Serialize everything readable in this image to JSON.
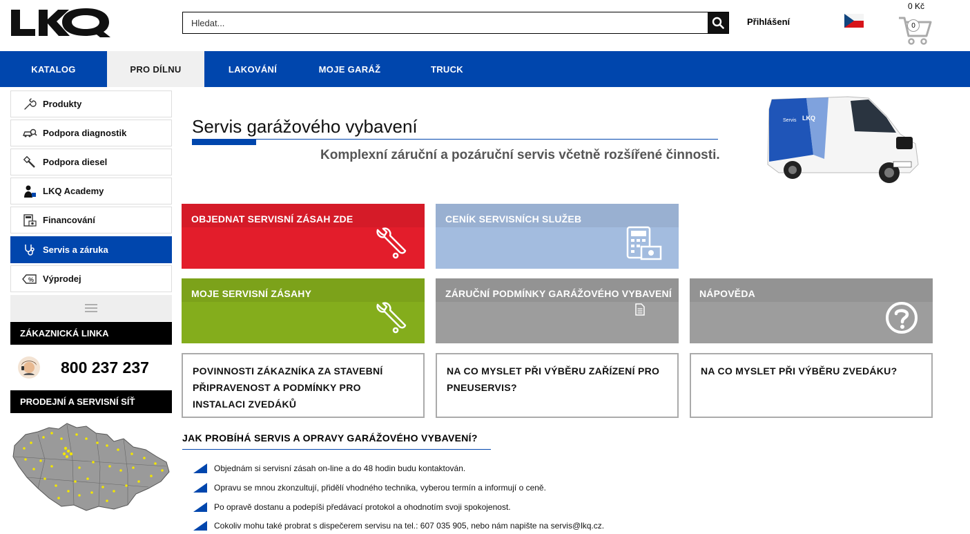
{
  "header": {
    "logo_text": "LKQ",
    "search_placeholder": "Hledat...",
    "login_label": "Přihlášení",
    "cart_price": "0 Kč",
    "cart_count": "0"
  },
  "nav": {
    "items": [
      {
        "label": "KATALOG"
      },
      {
        "label": "PRO DÍLNU"
      },
      {
        "label": "LAKOVÁNÍ"
      },
      {
        "label": "MOJE GARÁŽ"
      },
      {
        "label": "TRUCK"
      }
    ],
    "active_index": 1
  },
  "sidebar": {
    "items": [
      {
        "label": "Produkty",
        "icon": "wrench-icon"
      },
      {
        "label": "Podpora diagnostik",
        "icon": "car-search-icon"
      },
      {
        "label": "Podpora diesel",
        "icon": "injector-icon"
      },
      {
        "label": "LKQ Academy",
        "icon": "teacher-icon"
      },
      {
        "label": "Financování",
        "icon": "calculator-icon"
      },
      {
        "label": "Servis a záruka",
        "icon": "stethoscope-icon"
      },
      {
        "label": "Výprodej",
        "icon": "discount-tag-icon"
      }
    ],
    "active_index": 5,
    "hotline_title": "ZÁKAZNICKÁ LINKA",
    "hotline_number": "800 237 237",
    "network_title": "PRODEJNÍ A SERVISNÍ SÍŤ"
  },
  "main": {
    "title": "Servis garážového vybavení",
    "subtitle": "Komplexní záruční a pozáruční servis  včetně rozšířené činnosti.",
    "tiles": [
      {
        "label": "OBJEDNAT SERVISNÍ ZÁSAH ZDE",
        "color": "#e31d2b",
        "icon": "wrench-icon"
      },
      {
        "label": "CENÍK SERVISNÍCH SLUŽEB",
        "color": "#a3bcdf",
        "icon": "calculator-money-icon"
      },
      {
        "label": "MOJE SERVISNÍ ZÁSAHY",
        "color": "#84ad1c",
        "icon": "wrench-icon"
      },
      {
        "label": "ZÁRUČNÍ PODMÍNKY GARÁŽOVÉHO VYBAVENÍ",
        "color": "#9d9d9d",
        "icon": "document-icon"
      },
      {
        "label": "NÁPOVĚDA",
        "color": "#9d9d9d",
        "icon": "question-icon"
      }
    ],
    "boxes": [
      {
        "text": "POVINNOSTI ZÁKAZNÍKA ZA STAVEBNÍ PŘIPRAVENOST A PODMÍNKY PRO INSTALACI ZVEDÁKŮ"
      },
      {
        "text": "NA CO MYSLET PŘI VÝBĚRU ZAŘÍZENÍ PRO PNEUSERVIS?"
      },
      {
        "text": "NA CO MYSLET PŘI VÝBĚRU ZVEDÁKU?"
      }
    ],
    "process_title": "JAK PROBÍHÁ SERVIS A OPRAVY GARÁŽOVÉHO VYBAVENÍ?",
    "steps": [
      "Objednám si servisní zásah on-line a do 48 hodin budu kontaktován.",
      "Opravu se mnou zkonzultují, přidělí vhodného technika, vyberou termín a informují o ceně.",
      "Po opravě dostanu a podepíši předávací protokol a ohodnotím svoji spokojenost.",
      "Cokoliv mohu také probrat s dispečerem servisu na tel.: 607 035 905, nebo nám napište na servis@lkq.cz."
    ]
  },
  "colors": {
    "brand_blue": "#0046ad",
    "nav_active_bg": "#f0f0f0"
  }
}
